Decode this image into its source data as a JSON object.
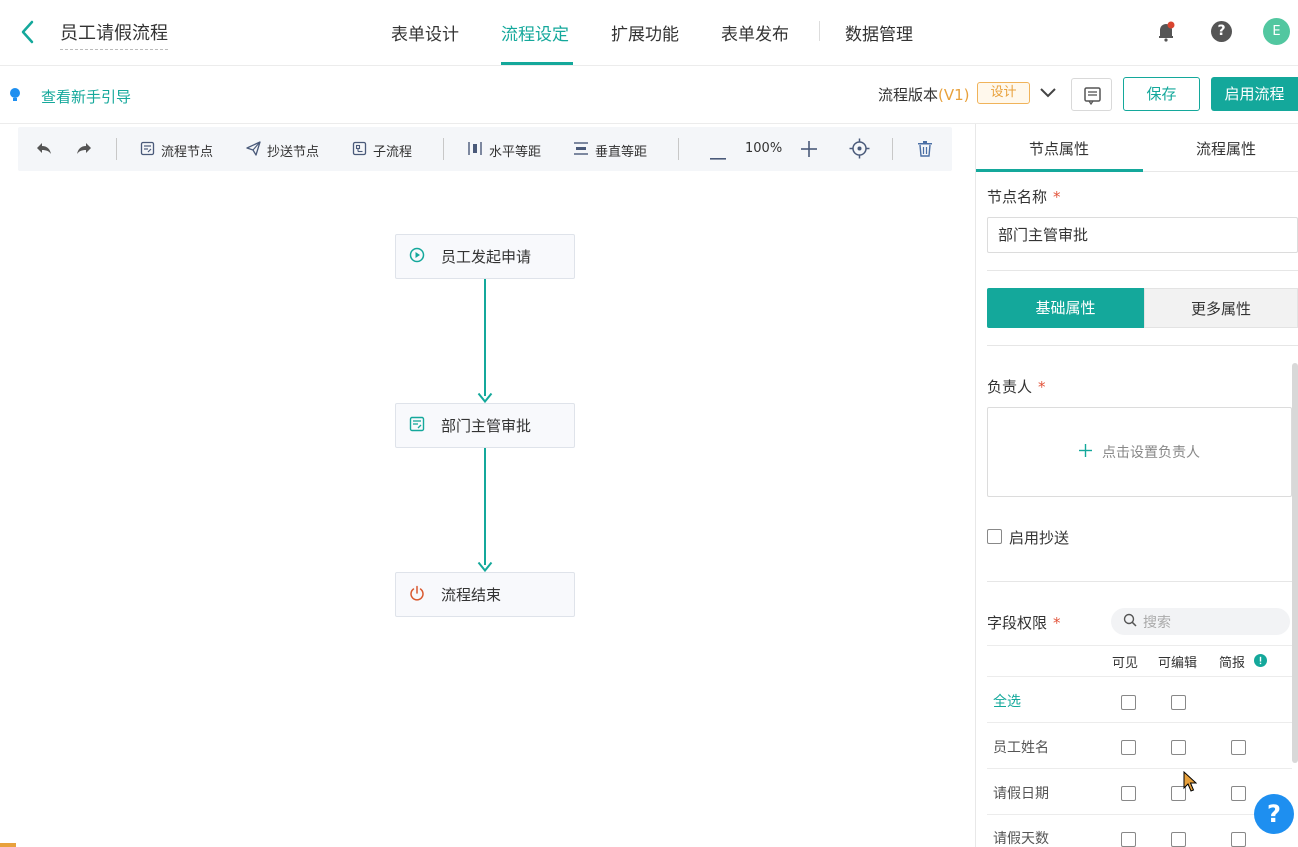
{
  "header": {
    "app_title": "员工请假流程",
    "tabs": [
      {
        "label": "表单设计"
      },
      {
        "label": "流程设定"
      },
      {
        "label": "扩展功能"
      },
      {
        "label": "表单发布"
      },
      {
        "label": "数据管理"
      }
    ],
    "active_tab_index": 1,
    "help_glyph": "?",
    "avatar_initial": "E"
  },
  "subbar": {
    "guide_link": "查看新手引导",
    "version_label": "流程版本",
    "version_number": "(V1)",
    "version_badge": "设计",
    "save_label": "保存",
    "enable_label": "启用流程"
  },
  "toolbar": {
    "flow_node": "流程节点",
    "cc_node": "抄送节点",
    "sub_flow": "子流程",
    "h_distribute": "水平等距",
    "v_distribute": "垂直等距",
    "zoom": "100%"
  },
  "canvas": {
    "nodes": [
      {
        "label": "员工发起申请",
        "icon": "play-circle-icon"
      },
      {
        "label": "部门主管审批",
        "icon": "form-icon"
      },
      {
        "label": "流程结束",
        "icon": "power-icon"
      }
    ]
  },
  "panel": {
    "tabs": [
      {
        "label": "节点属性"
      },
      {
        "label": "流程属性"
      }
    ],
    "node_name_label": "节点名称",
    "node_name_value": "部门主管审批",
    "required_mark": "*",
    "seg_basic": "基础属性",
    "seg_more": "更多属性",
    "assignee_label": "负责人",
    "assignee_placeholder": "点击设置负责人",
    "cc_enable_label": "启用抄送",
    "field_perm_label": "字段权限",
    "search_placeholder": "搜索",
    "columns": [
      "可见",
      "可编辑",
      "简报"
    ],
    "rows": [
      {
        "label": "全选"
      },
      {
        "label": "员工姓名"
      },
      {
        "label": "请假日期"
      },
      {
        "label": "请假天数"
      }
    ]
  },
  "colors": {
    "accent": "#14a89b",
    "warning": "#e8a13c",
    "required": "#e2543b"
  }
}
